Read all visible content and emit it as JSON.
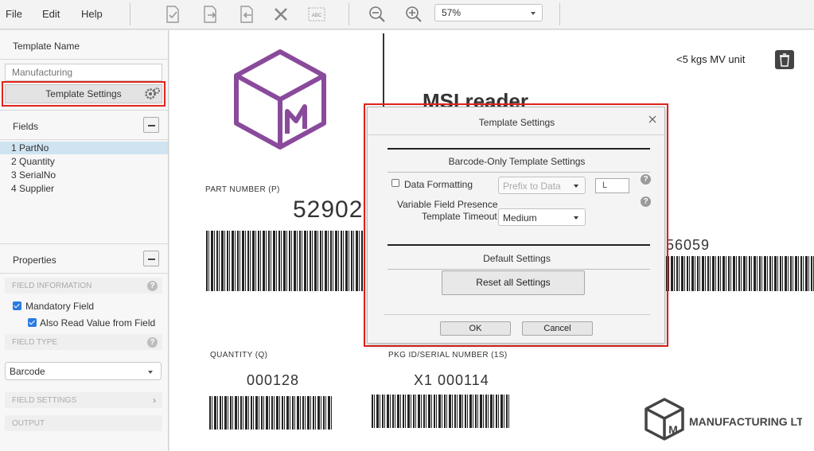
{
  "menu": {
    "file": "File",
    "edit": "Edit",
    "help": "Help"
  },
  "toolbar": {
    "icons": [
      "check-document-icon",
      "import-document-icon",
      "export-document-icon",
      "delete-x-icon",
      "abc-text-icon",
      "zoom-out-icon",
      "zoom-in-icon"
    ],
    "zoom_value": "57%"
  },
  "left_panel": {
    "template_name_header": "Template Name",
    "template_name_placeholder": "Manufacturing",
    "template_settings_button": "Template Settings",
    "fields_header": "Fields",
    "fields": [
      "1 PartNo",
      "2 Quantity",
      "3 SerialNo",
      "4 Supplier"
    ],
    "selected_field_index": 0,
    "properties_header": "Properties",
    "field_information": "FIELD INFORMATION",
    "mandatory_field": "Mandatory Field",
    "also_read_value": "Also Read Value from Field",
    "field_type": "FIELD TYPE",
    "field_type_value": "Barcode",
    "field_settings": "FIELD SETTINGS",
    "output": "OUTPUT"
  },
  "canvas": {
    "unit_text": "<5 kgs  MV unit",
    "title": "MSI reader",
    "part_number_label": "PART NUMBER (P)",
    "part_number_value": "52902",
    "supplier_value": "56059",
    "quantity_label": "QUANTITY (Q)",
    "quantity_value": "000128",
    "serial_label": "PKG ID/SERIAL NUMBER (1S)",
    "serial_value": "X1 000114",
    "company_name": "MANUFACTURING LTD",
    "logo_letter": "M"
  },
  "dialog": {
    "title": "Template Settings",
    "barcode_section": "Barcode-Only Template Settings",
    "data_formatting_label": "Data Formatting",
    "prefix_option": "Prefix to Data",
    "prefix_input_value": "L",
    "variable_field_label": "Variable Field Presence",
    "timeout_label": "Template Timeout",
    "timeout_value": "Medium",
    "default_section": "Default Settings",
    "reset_button": "Reset all Settings",
    "ok_button": "OK",
    "cancel_button": "Cancel"
  },
  "colors": {
    "highlight_red": "#e3241b",
    "logo_purple": "#8a4a9c",
    "selected_row": "#cfe3f1",
    "checkbox_blue": "#2b7be3"
  }
}
